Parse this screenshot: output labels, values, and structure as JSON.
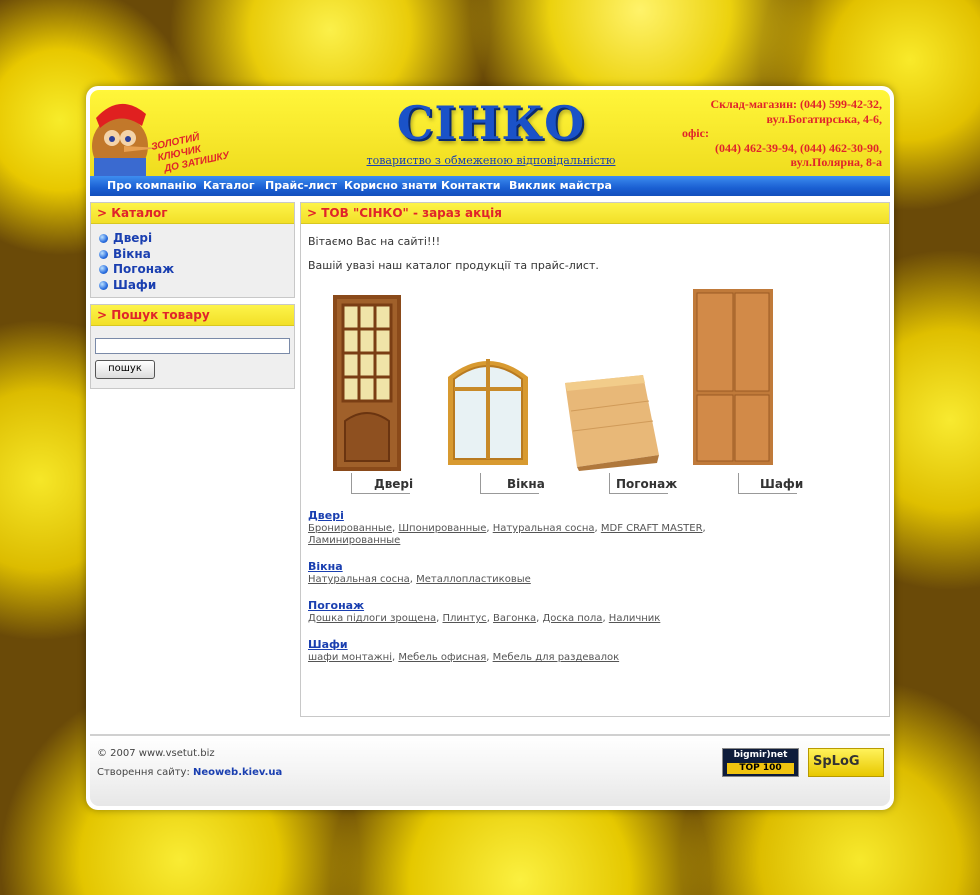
{
  "header": {
    "mascot_text": "ЗОЛОТИЙ КЛЮЧИК ДО ЗАТИШКУ",
    "logo_title": "СІНКО",
    "logo_subtitle": "товариство з обмеженою відповідальністю",
    "contacts": [
      "Склад-магазин:   (044) 599-42-32,",
      "вул.Богатирська, 4-6,",
      "офіс:",
      "(044) 462-39-94, (044) 462-30-90,",
      "вул.Полярна, 8-а"
    ]
  },
  "menu": [
    "Про компанію",
    "Каталог",
    "Прайс-лист",
    "Корисно знати",
    "Контакти",
    "Виклик майстра"
  ],
  "sidebar": {
    "catalog_title": "> Каталог",
    "catalog_items": [
      "Двері",
      "Вікна",
      "Погонаж",
      "Шафи"
    ],
    "search_title": "> Пошук товару",
    "search_value": "",
    "search_button": "пошук"
  },
  "main": {
    "title": "> ТОВ \"СІНКО\" - зараз акція",
    "welcome": "Вітаємо Вас на сайті!!!",
    "intro": "Вашій увазі наш каталог продукції та прайс-лист.",
    "products": [
      "Двері",
      "Вікна",
      "Погонаж",
      "Шафи"
    ],
    "categories": [
      {
        "title": "Двері",
        "links": [
          "Бронированные",
          "Шпонированные",
          "Натуральная сосна",
          "MDF CRAFT MASTER",
          "Ламинированные"
        ]
      },
      {
        "title": "Вікна",
        "links": [
          "Натуральная сосна",
          "Металлопластиковые"
        ]
      },
      {
        "title": "Погонаж",
        "links": [
          "Дошка підлоги зрощена",
          "Плинтус",
          "Вагонка",
          "Доска пола",
          "Наличник"
        ]
      },
      {
        "title": "Шафи",
        "links": [
          "шафи монтажні",
          "Мебель офисная",
          "Мебель для раздевалок"
        ]
      }
    ]
  },
  "footer": {
    "copyright": "© 2007 www.vsetut.biz",
    "created_label": "Створення сайту:",
    "created_link": "Neoweb.kiev.ua",
    "badge1_top": "bigmir)net",
    "badge1_bottom": "TOP 100",
    "badge2": "SpLoG"
  },
  "colors": {
    "accent_red": "#e0242a",
    "link_blue": "#1a3fb0",
    "menu_blue": "#1a5fd2",
    "header_yellow": "#f6e62a"
  }
}
